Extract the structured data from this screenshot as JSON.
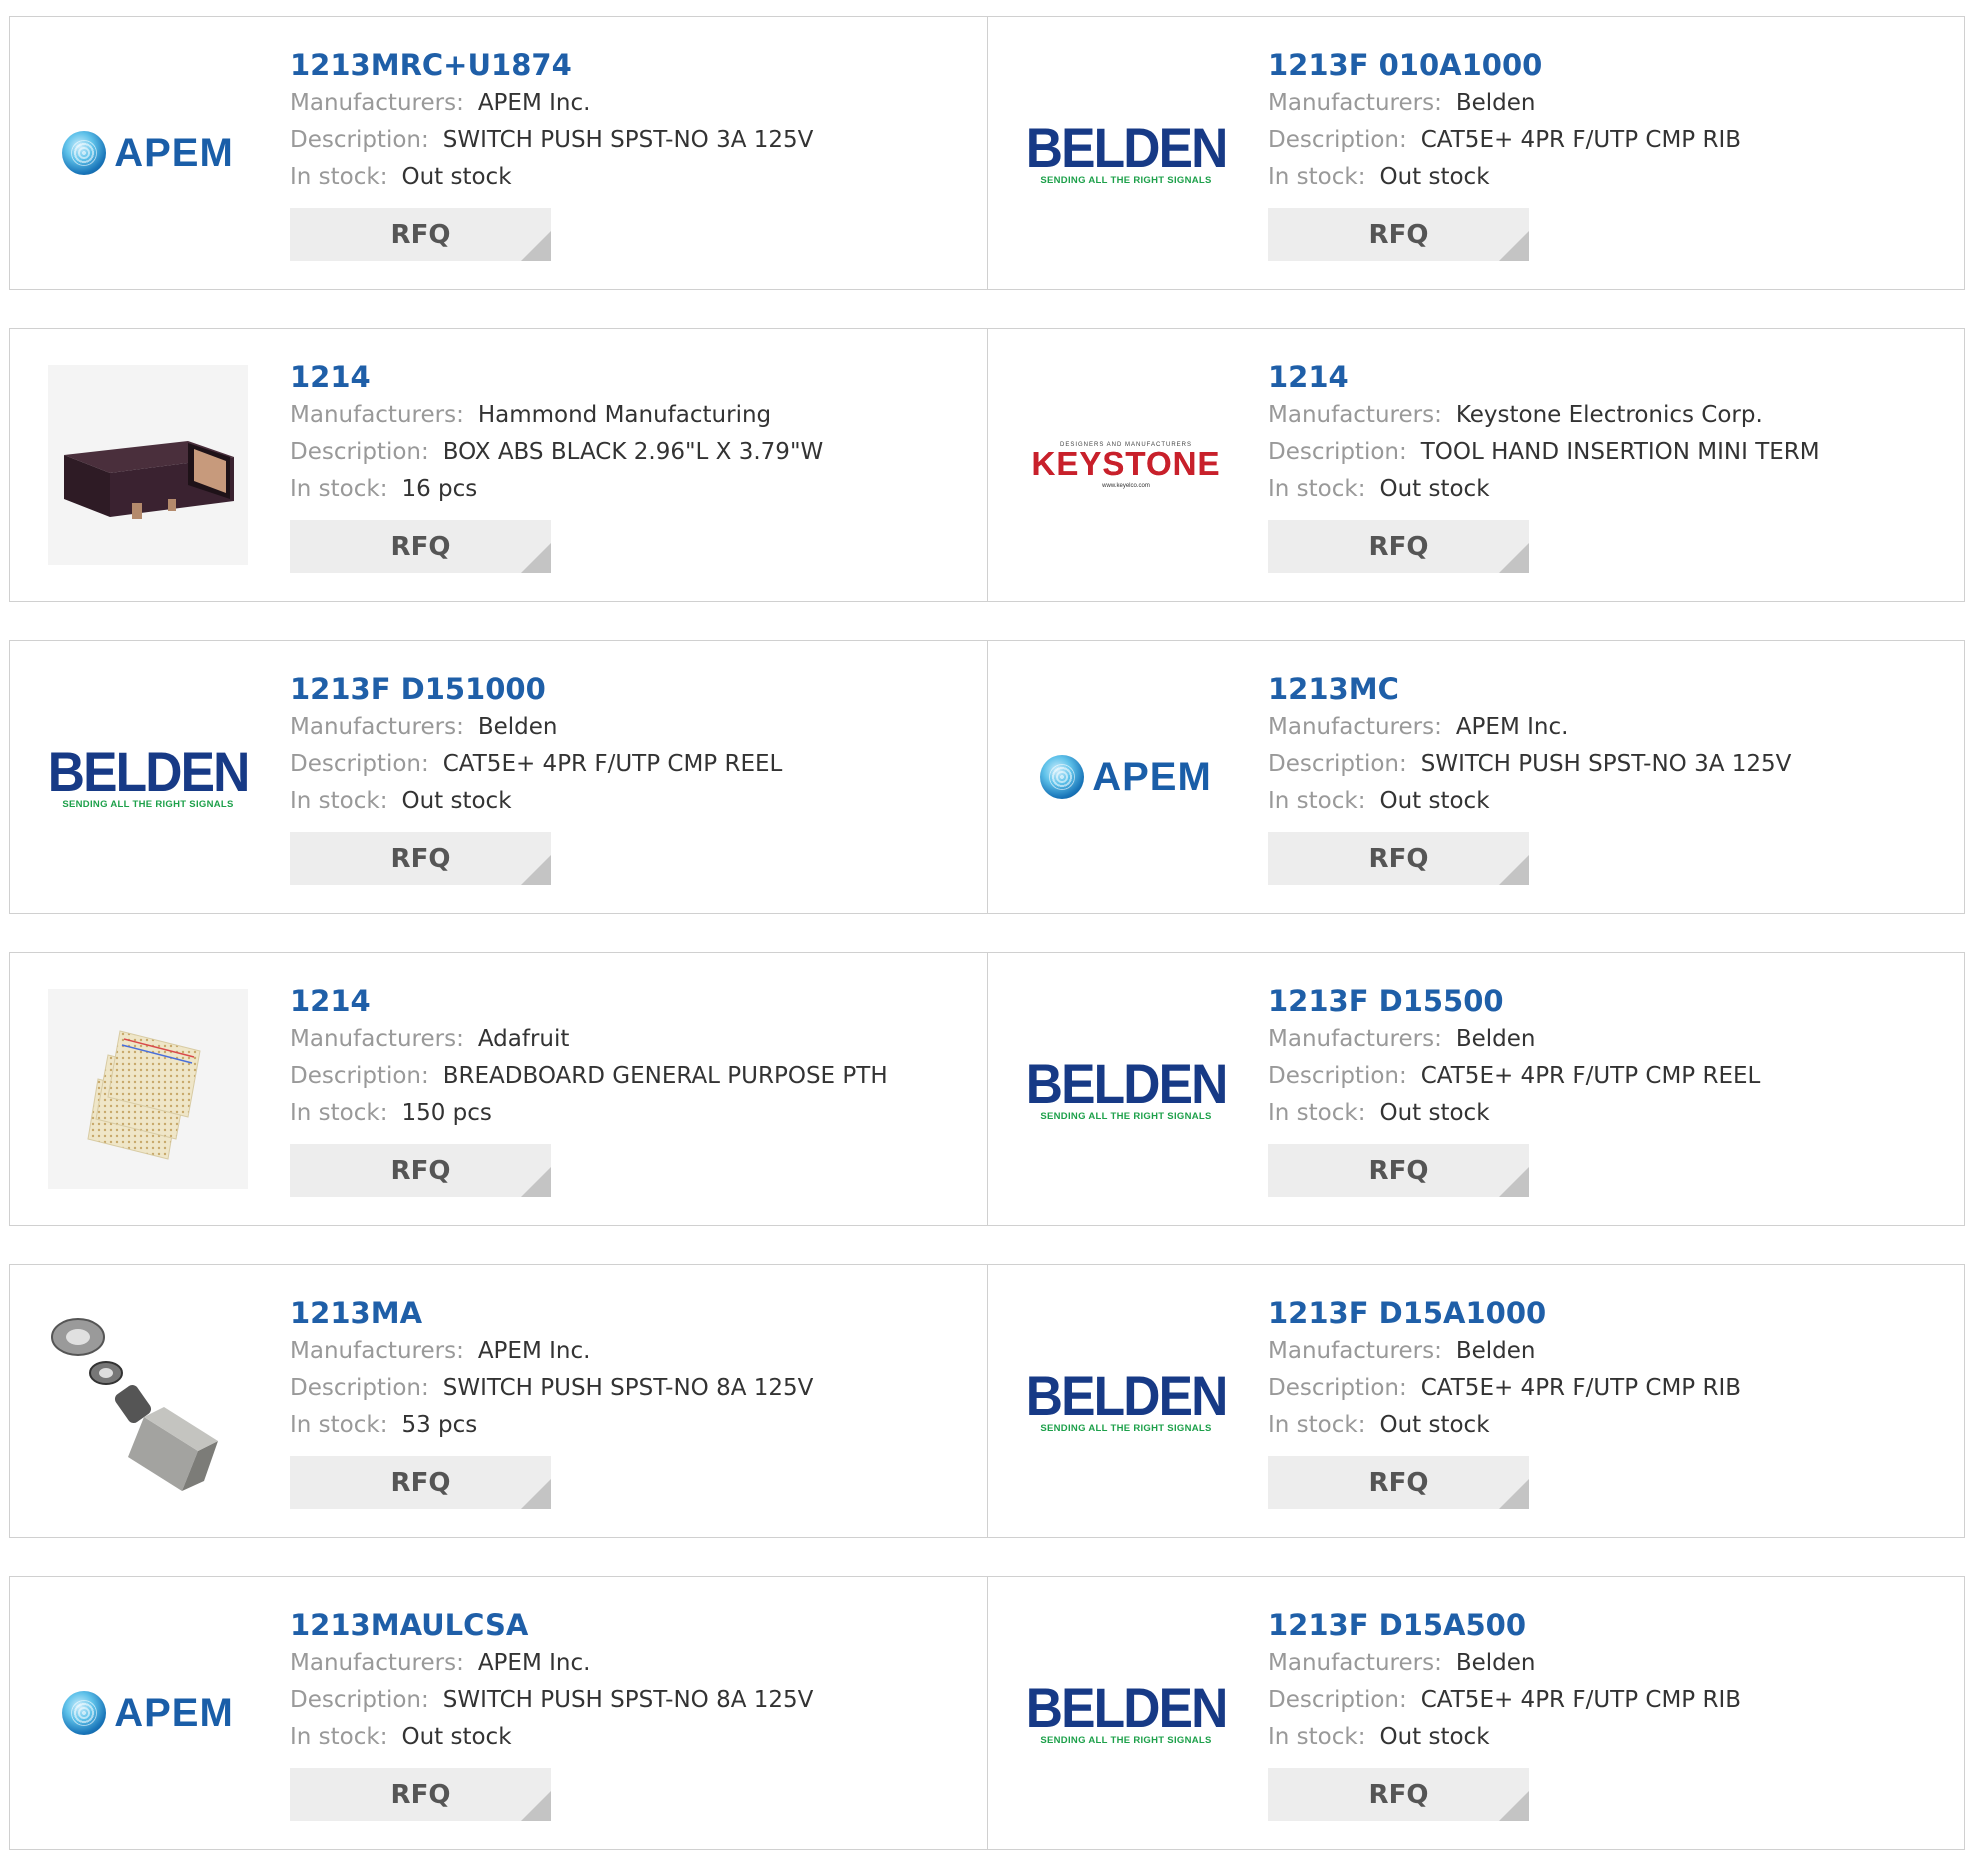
{
  "labels": {
    "manufacturer": "Manufacturers:",
    "description": "Description:",
    "stock": "In stock:",
    "rfq": "RFQ"
  },
  "logos": {
    "apem": "APEM",
    "belden": "BELDEN",
    "belden_tagline": "SENDING ALL THE RIGHT SIGNALS",
    "keystone": "KEYSTONE",
    "keystone_small": "DESIGNERS AND MANUFACTURERS",
    "keystone_url": "www.keyelco.com"
  },
  "colors": {
    "part_link": "#1f5fa8",
    "label": "#999999",
    "value": "#333333",
    "rfq_bg": "#ededed"
  },
  "products": [
    {
      "part": "1213MRC+U1874",
      "manufacturer": "APEM Inc.",
      "description": "SWITCH PUSH SPST-NO 3A 125V",
      "stock": "Out stock",
      "image": "apem-logo"
    },
    {
      "part": "1213F 010A1000",
      "manufacturer": "Belden",
      "description": "CAT5E+ 4PR F/UTP CMP RIB",
      "stock": "Out stock",
      "image": "belden-logo"
    },
    {
      "part": "1214",
      "manufacturer": "Hammond Manufacturing",
      "description": "BOX ABS BLACK 2.96\"L X 3.79\"W",
      "stock": "16 pcs",
      "image": "black-box-photo"
    },
    {
      "part": "1214",
      "manufacturer": "Keystone Electronics Corp.",
      "description": "TOOL HAND INSERTION MINI TERM",
      "stock": "Out stock",
      "image": "keystone-logo"
    },
    {
      "part": "1213F D151000",
      "manufacturer": "Belden",
      "description": "CAT5E+ 4PR F/UTP CMP REEL",
      "stock": "Out stock",
      "image": "belden-logo"
    },
    {
      "part": "1213MC",
      "manufacturer": "APEM Inc.",
      "description": "SWITCH PUSH SPST-NO 3A 125V",
      "stock": "Out stock",
      "image": "apem-logo"
    },
    {
      "part": "1214",
      "manufacturer": "Adafruit",
      "description": "BREADBOARD GENERAL PURPOSE PTH",
      "stock": "150 pcs",
      "image": "breadboard-photo"
    },
    {
      "part": "1213F D15500",
      "manufacturer": "Belden",
      "description": "CAT5E+ 4PR F/UTP CMP REEL",
      "stock": "Out stock",
      "image": "belden-logo"
    },
    {
      "part": "1213MA",
      "manufacturer": "APEM Inc.",
      "description": "SWITCH PUSH SPST-NO 8A 125V",
      "stock": "53 pcs",
      "image": "push-switch-photo"
    },
    {
      "part": "1213F D15A1000",
      "manufacturer": "Belden",
      "description": "CAT5E+ 4PR F/UTP CMP RIB",
      "stock": "Out stock",
      "image": "belden-logo"
    },
    {
      "part": "1213MAULCSA",
      "manufacturer": "APEM Inc.",
      "description": "SWITCH PUSH SPST-NO 8A 125V",
      "stock": "Out stock",
      "image": "apem-logo"
    },
    {
      "part": "1213F D15A500",
      "manufacturer": "Belden",
      "description": "CAT5E+ 4PR F/UTP CMP RIB",
      "stock": "Out stock",
      "image": "belden-logo"
    }
  ]
}
